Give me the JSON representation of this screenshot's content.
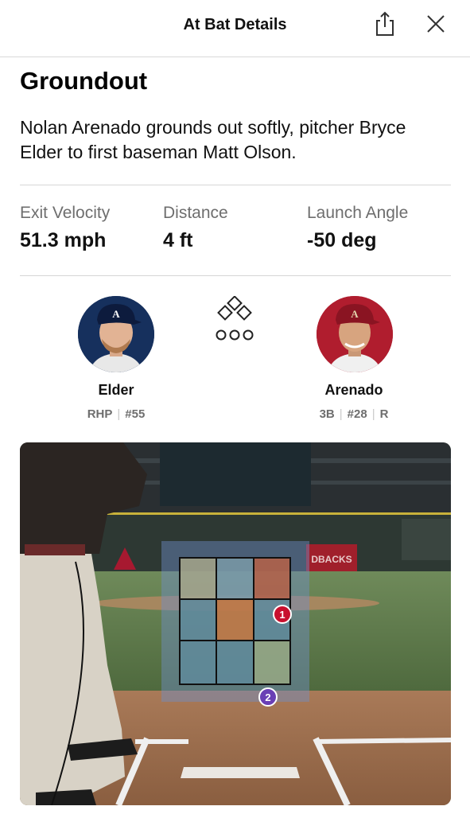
{
  "header": {
    "title": "At Bat Details",
    "share_icon": "share-icon",
    "close_icon": "close-icon"
  },
  "result": {
    "title": "Groundout",
    "description": "Nolan Arenado grounds out softly, pitcher Bryce Elder to first baseman Matt Olson."
  },
  "stats": [
    {
      "label": "Exit Velocity",
      "value": "51.3 mph"
    },
    {
      "label": "Distance",
      "value": "4 ft"
    },
    {
      "label": "Launch Angle",
      "value": "-50 deg"
    }
  ],
  "pitcher": {
    "name": "Elder",
    "throws": "RHP",
    "number": "#55",
    "team_color": "#13274f"
  },
  "batter": {
    "name": "Arenado",
    "position": "3B",
    "number": "#28",
    "bats": "R",
    "team_color": "#a71930"
  },
  "bases_icon": "bases-icon",
  "strike_zone": {
    "pitches": [
      {
        "number": "1",
        "color": "#c8102e"
      },
      {
        "number": "2",
        "color": "#6a3fb5"
      }
    ]
  },
  "scene": {
    "backstop_text": "DBACKS"
  }
}
